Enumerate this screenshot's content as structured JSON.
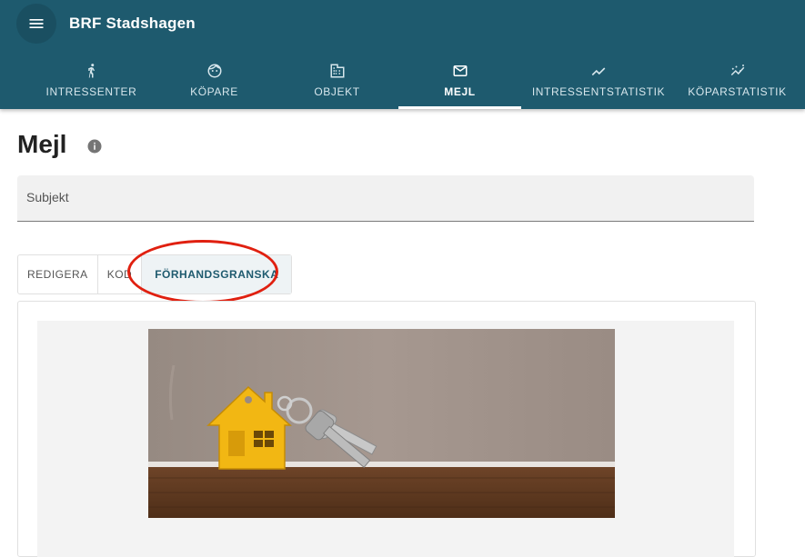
{
  "app": {
    "title": "BRF Stadshagen"
  },
  "nav": {
    "tabs": [
      {
        "label": "INTRESSENTER",
        "icon": "person-pin-icon"
      },
      {
        "label": "KÖPARE",
        "icon": "face-icon"
      },
      {
        "label": "OBJEKT",
        "icon": "building-icon"
      },
      {
        "label": "MEJL",
        "icon": "mail-icon",
        "active": true
      },
      {
        "label": "INTRESSENTSTATISTIK",
        "icon": "trending-up-icon"
      },
      {
        "label": "KÖPARSTATISTIK",
        "icon": "scatter-trend-icon"
      }
    ]
  },
  "main": {
    "title": "Mejl",
    "subject": {
      "placeholder": "Subjekt",
      "value": ""
    },
    "editor_tabs": [
      {
        "label": "REDIGERA"
      },
      {
        "label": "KOD"
      },
      {
        "label": "FÖRHANDSGRANSKA",
        "active": true
      }
    ]
  },
  "colors": {
    "primary": "#1e5a6e",
    "highlight": "#e02010"
  }
}
